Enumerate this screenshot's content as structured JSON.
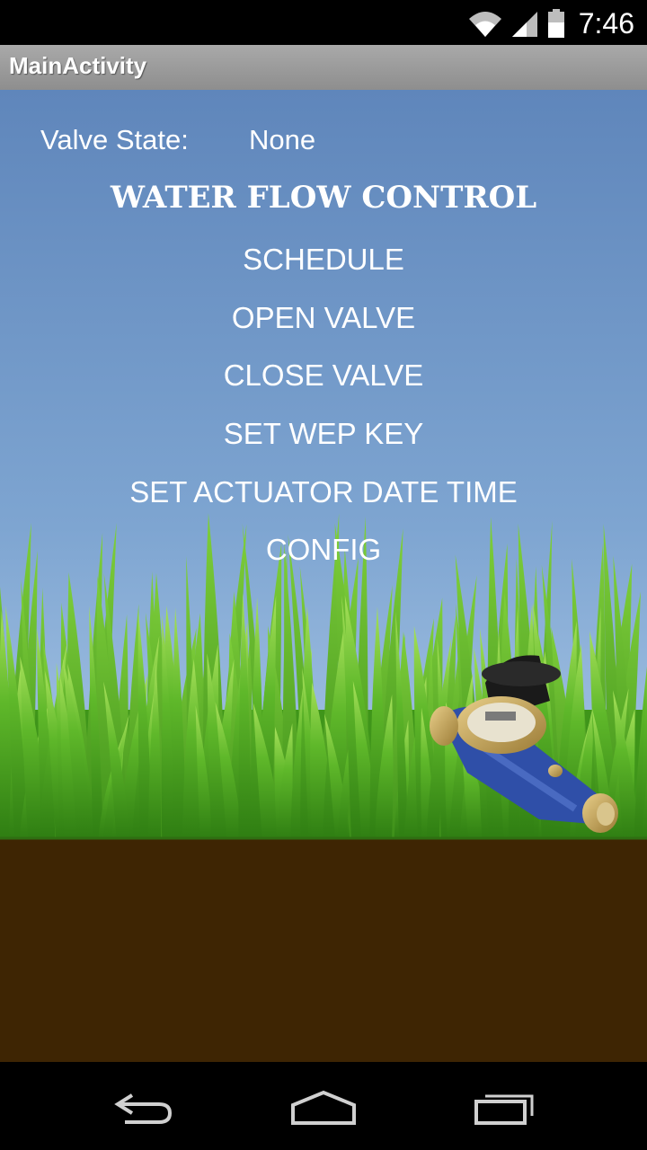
{
  "status_bar": {
    "time": "7:46",
    "icons": [
      "wifi-icon",
      "signal-icon",
      "battery-icon"
    ]
  },
  "app": {
    "title": "MainActivity"
  },
  "main": {
    "valve_state_label": "Valve State:",
    "valve_state_value": "None",
    "heading": "WATER FLOW CONTROL",
    "buttons": [
      {
        "label": "SCHEDULE"
      },
      {
        "label": "OPEN VALVE"
      },
      {
        "label": "CLOSE VALVE"
      },
      {
        "label": "SET WEP KEY"
      },
      {
        "label": "SET ACTUATOR DATE TIME"
      },
      {
        "label": "CONFIG"
      }
    ]
  },
  "nav": {
    "icons": [
      "back-icon",
      "home-icon",
      "recent-apps-icon"
    ]
  },
  "colors": {
    "sky_top": "#5f86bb",
    "grass": "#49a41d",
    "soil": "#3e2503",
    "meter_blue": "#2f4fa8"
  }
}
